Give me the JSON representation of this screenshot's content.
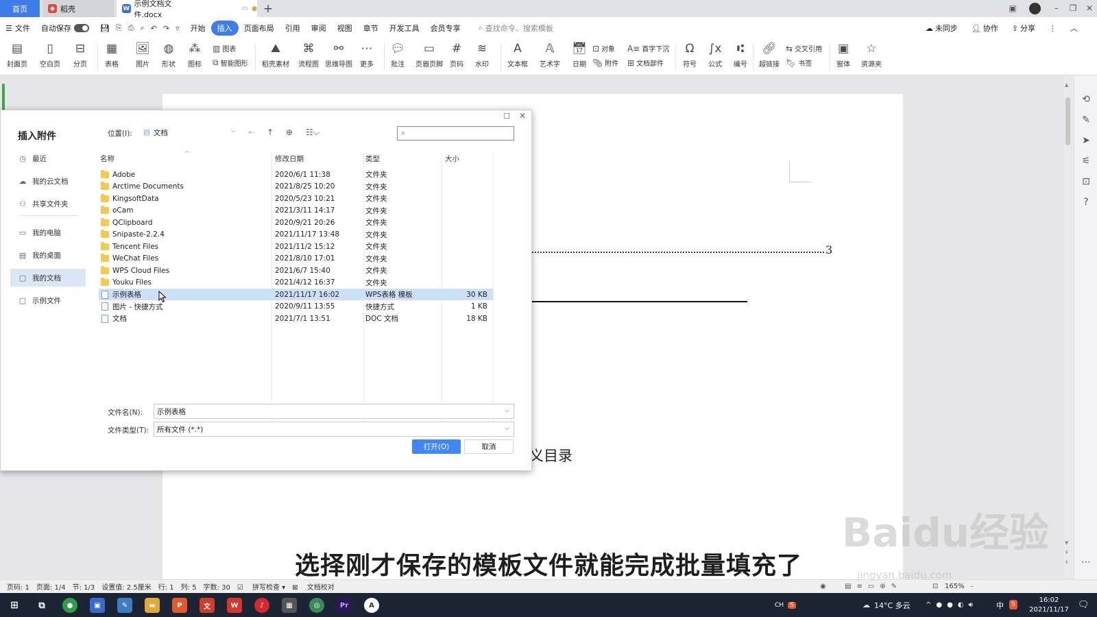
{
  "tabs": {
    "home": "首页",
    "daoke": "稻壳",
    "document": "示例文档文件.docx"
  },
  "menu": {
    "file": "文件",
    "autosave": "自动保存",
    "items": [
      "开始",
      "插入",
      "页面布局",
      "引用",
      "审阅",
      "视图",
      "章节",
      "开发工具",
      "会员专享"
    ],
    "active_index": 1,
    "search_placeholder": "查找命令、搜索模板",
    "sync": "未同步",
    "collaborate": "协作",
    "share": "分享"
  },
  "ribbon": {
    "cover": "封面页",
    "blank": "空白页",
    "pagebreak": "分页",
    "table": "表格",
    "picture": "图片",
    "shape": "形状",
    "icon": "图标",
    "chart": "图表",
    "smartart": "智能图形",
    "daoke_material": "稻壳素材",
    "flowchart": "流程图",
    "mindmap": "思维导图",
    "more": "更多",
    "comment": "批注",
    "header_footer": "页眉页脚",
    "page_number": "页码",
    "watermark": "水印",
    "textbox": "文本框",
    "wordart": "艺术字",
    "date": "日期",
    "object": "对象",
    "attachment": "附件",
    "dropcap": "首字下沉",
    "doc_parts": "文档部件",
    "symbol": "符号",
    "formula": "公式",
    "numbering": "编号",
    "hyperlink": "超链接",
    "cross_ref": "交叉引用",
    "bookmark": "书签",
    "form": "窗体",
    "resources": "资源夹"
  },
  "document": {
    "toc_page": "3",
    "heading_fragment": "义目录"
  },
  "dialog": {
    "title": "插入附件",
    "location_label": "位置(I):",
    "location_value": "文档",
    "sidebar": [
      "最近",
      "我的云文档",
      "共享文件夹",
      "我的电脑",
      "我的桌面",
      "我的文档",
      "示例文件"
    ],
    "sidebar_selected": 5,
    "columns": [
      "名称",
      "修改日期",
      "类型",
      "大小"
    ],
    "files": [
      {
        "name": "Adobe",
        "date": "2020/6/1 11:38",
        "type": "文件夹",
        "size": "",
        "kind": "folder"
      },
      {
        "name": "Arctime Documents",
        "date": "2021/8/25 10:20",
        "type": "文件夹",
        "size": "",
        "kind": "folder"
      },
      {
        "name": "KingsoftData",
        "date": "2020/5/23 10:21",
        "type": "文件夹",
        "size": "",
        "kind": "folder"
      },
      {
        "name": "oCam",
        "date": "2021/3/11 14:17",
        "type": "文件夹",
        "size": "",
        "kind": "folder"
      },
      {
        "name": "QClipboard",
        "date": "2020/9/21 20:26",
        "type": "文件夹",
        "size": "",
        "kind": "folder"
      },
      {
        "name": "Snipaste-2.2.4",
        "date": "2021/11/17 13:48",
        "type": "文件夹",
        "size": "",
        "kind": "folder"
      },
      {
        "name": "Tencent Files",
        "date": "2021/11/2 15:12",
        "type": "文件夹",
        "size": "",
        "kind": "folder"
      },
      {
        "name": "WeChat Files",
        "date": "2021/8/10 17:01",
        "type": "文件夹",
        "size": "",
        "kind": "folder"
      },
      {
        "name": "WPS Cloud Files",
        "date": "2021/6/7 15:40",
        "type": "文件夹",
        "size": "",
        "kind": "folder"
      },
      {
        "name": "Youku Files",
        "date": "2021/4/12 16:37",
        "type": "文件夹",
        "size": "",
        "kind": "folder"
      },
      {
        "name": "示例表格",
        "date": "2021/11/17 16:02",
        "type": "WPS表格 模板",
        "size": "30 KB",
        "kind": "file",
        "selected": true
      },
      {
        "name": "图片 - 快捷方式",
        "date": "2020/9/11 13:55",
        "type": "快捷方式",
        "size": "1 KB",
        "kind": "shortcut"
      },
      {
        "name": "文档",
        "date": "2021/7/1 13:51",
        "type": "DOC 文档",
        "size": "18 KB",
        "kind": "file"
      }
    ],
    "filename_label": "文件名(N):",
    "filename_value": "示例表格",
    "filetype_label": "文件类型(T):",
    "filetype_value": "所有文件 (*.*)",
    "open_button": "打开(O)",
    "cancel_button": "取消"
  },
  "statusbar": {
    "page_num": "页码: 1",
    "pages": "页面: 1/4",
    "section": "节: 1/3",
    "setting": "设置值: 2.5厘米",
    "row": "行: 1",
    "col": "列: 5",
    "words": "字数: 30",
    "spellcheck": "拼写检查",
    "proofread": "文档校对",
    "zoom": "165%"
  },
  "taskbar": {
    "weather": "14°C 多云",
    "ime_lang": "中",
    "time": "16:02",
    "date": "2021/11/17"
  },
  "subtitle": "选择刚才保存的模板文件就能完成批量填充了",
  "watermark_text": "Baidu经验",
  "watermark_url": "jingyan.baidu.com",
  "colors": {
    "accent": "#3f7ee8",
    "selected_row": "#cce0f7",
    "folder": "#f3c94f",
    "taskbar": "#1b2533"
  }
}
